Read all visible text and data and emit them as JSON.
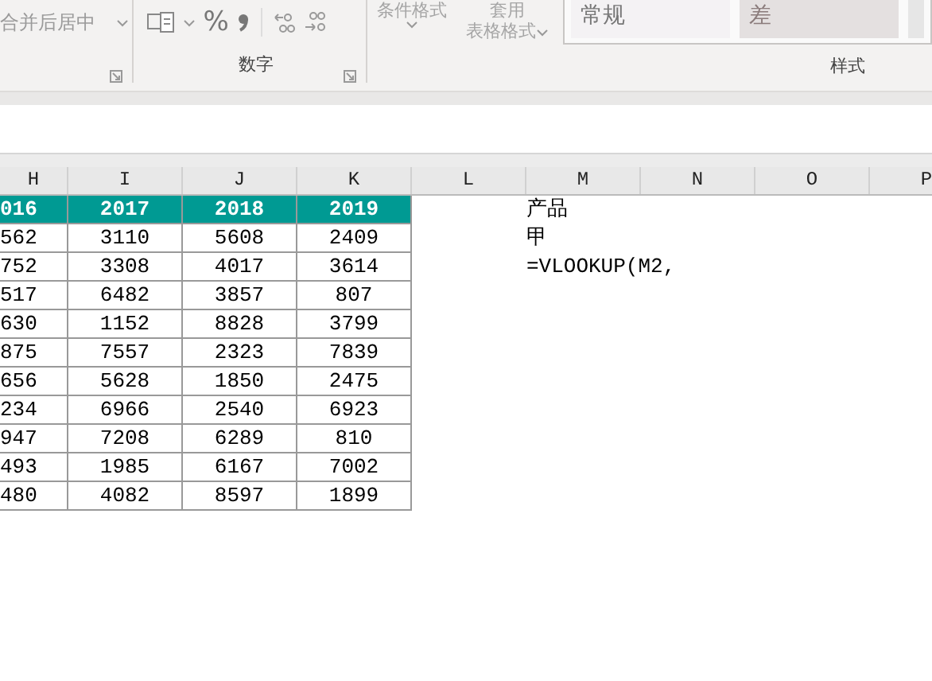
{
  "ribbon": {
    "alignment_group": {
      "merge_button": "合并后居中"
    },
    "number_group": {
      "percent_button": "%",
      "label": "数字"
    },
    "styles_group": {
      "conditional_format": "条件格式",
      "table_format": [
        "套用",
        "表格格式"
      ],
      "cell_styles": [
        {
          "label": "常规",
          "kind": "normal"
        },
        {
          "label": "差",
          "kind": "bad"
        }
      ],
      "label": "样式"
    }
  },
  "sheet": {
    "columns": [
      "H",
      "I",
      "J",
      "K",
      "L",
      "M",
      "N",
      "O",
      "P"
    ],
    "header_row": [
      "016",
      "2017",
      "2018",
      "2019"
    ],
    "rows": [
      [
        "562",
        "3110",
        "5608",
        "2409"
      ],
      [
        "752",
        "3308",
        "4017",
        "3614"
      ],
      [
        "517",
        "6482",
        "3857",
        "807"
      ],
      [
        "630",
        "1152",
        "8828",
        "3799"
      ],
      [
        "875",
        "7557",
        "2323",
        "7839"
      ],
      [
        "656",
        "5628",
        "1850",
        "2475"
      ],
      [
        "234",
        "6966",
        "2540",
        "6923"
      ],
      [
        "947",
        "7208",
        "6289",
        "810"
      ],
      [
        "493",
        "1985",
        "6167",
        "7002"
      ],
      [
        "480",
        "4082",
        "8597",
        "1899"
      ]
    ],
    "column_m": [
      "产品",
      "甲",
      "=VLOOKUP(M2,"
    ]
  }
}
